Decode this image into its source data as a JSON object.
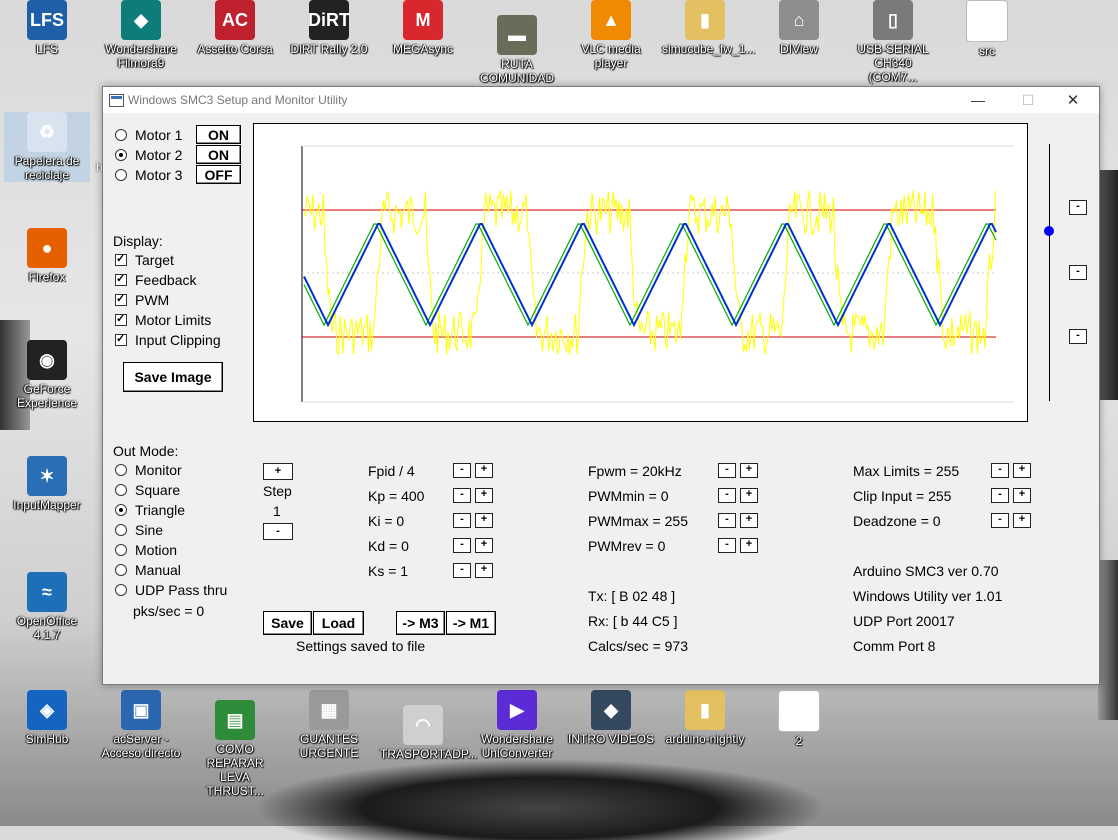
{
  "desktop": {
    "icons": [
      {
        "id": "lfs",
        "label": "LFS",
        "color": "#1f5fa8",
        "glyph": "LFS"
      },
      {
        "id": "filmora",
        "label": "Wondershare Filmora9",
        "color": "#0e7c7b",
        "glyph": "◆"
      },
      {
        "id": "assetto",
        "label": "Assetto Corsa",
        "color": "#c0212f",
        "glyph": "AC"
      },
      {
        "id": "dirt",
        "label": "DiRT Rally 2.0",
        "color": "#222222",
        "glyph": "DiRT"
      },
      {
        "id": "megasync",
        "label": "MEGAsync",
        "color": "#d9272e",
        "glyph": "M"
      },
      {
        "id": "ruta",
        "label": "RUTA COMUNIDAD",
        "color": "#6b6b5a",
        "glyph": "▬"
      },
      {
        "id": "vlc",
        "label": "VLC media player",
        "color": "#f08a00",
        "glyph": "▲"
      },
      {
        "id": "simucube",
        "label": "simucube_fw_1...",
        "color": "#e3c060",
        "glyph": "▮"
      },
      {
        "id": "diview",
        "label": "DIView",
        "color": "#8d8d8d",
        "glyph": "⌂"
      },
      {
        "id": "usbserial",
        "label": "USB-SERIAL CH340 (COM7...",
        "color": "#7a7a7a",
        "glyph": "▯"
      },
      {
        "id": "src",
        "label": "src",
        "color": "#ffffff",
        "glyph": ""
      },
      {
        "id": "recycle",
        "label": "Papelera de reciclaje",
        "color": "#d7e3ef",
        "glyph": "♻"
      },
      {
        "id": "firefox",
        "label": "Firefox",
        "color": "#e66000",
        "glyph": "●"
      },
      {
        "id": "geforce",
        "label": "GeForce Experience",
        "color": "#222222",
        "glyph": "◉"
      },
      {
        "id": "inputmapper",
        "label": "InputMapper",
        "color": "#2a6fb5",
        "glyph": "✶"
      },
      {
        "id": "openoffice",
        "label": "OpenOffice 4.1.7",
        "color": "#1d6fb8",
        "glyph": "≈"
      },
      {
        "id": "simhub",
        "label": "SimHub",
        "color": "#1565c0",
        "glyph": "◈"
      },
      {
        "id": "acserver",
        "label": "acServer - Acceso directo",
        "color": "#2b66b0",
        "glyph": "▣"
      },
      {
        "id": "reparar",
        "label": "COMO REPARAR LEVA THRUST...",
        "color": "#2e8b3a",
        "glyph": "▤"
      },
      {
        "id": "guantes",
        "label": "GUANTES URGENTE",
        "color": "#9a9a9a",
        "glyph": "▦"
      },
      {
        "id": "trasportadp",
        "label": "TRASPORTADP...",
        "color": "#cfcfcf",
        "glyph": "◠"
      },
      {
        "id": "uniconverter",
        "label": "Wondershare UniConverter",
        "color": "#5b2bd6",
        "glyph": "▶"
      },
      {
        "id": "introvideos",
        "label": "INTRO VIDEOS",
        "color": "#34495e",
        "glyph": "◆"
      },
      {
        "id": "arduino",
        "label": "arduino-nightly",
        "color": "#e3c060",
        "glyph": "▮"
      },
      {
        "id": "two",
        "label": "2",
        "color": "#ffffff",
        "glyph": ""
      }
    ],
    "partial_label": "h"
  },
  "window": {
    "title": "Windows SMC3 Setup and Monitor Utility",
    "minimize_glyph": "—",
    "maximize_glyph": "☐",
    "close_glyph": "✕"
  },
  "motors": [
    {
      "label": "Motor 1",
      "state": "ON",
      "selected": false
    },
    {
      "label": "Motor 2",
      "state": "ON",
      "selected": true
    },
    {
      "label": "Motor 3",
      "state": "OFF",
      "selected": false
    }
  ],
  "display": {
    "heading": "Display:",
    "items": [
      {
        "label": "Target",
        "checked": true
      },
      {
        "label": "Feedback",
        "checked": true
      },
      {
        "label": "PWM",
        "checked": true
      },
      {
        "label": "Motor Limits",
        "checked": true
      },
      {
        "label": "Input Clipping",
        "checked": true
      }
    ],
    "save_image": "Save Image"
  },
  "plot": {
    "colors": {
      "limit": "#cc0000",
      "target": "#00b000",
      "feedback": "#0030d0",
      "pwm": "#ffff00",
      "midline": "#cccccc",
      "axis": "#000000"
    },
    "slider_marker_color": "#0000ff"
  },
  "side_buttons": [
    "-",
    "-",
    "-"
  ],
  "out_mode": {
    "heading": "Out Mode:",
    "options": [
      {
        "label": "Monitor",
        "selected": false
      },
      {
        "label": "Square",
        "selected": false
      },
      {
        "label": "Triangle",
        "selected": true
      },
      {
        "label": "Sine",
        "selected": false
      },
      {
        "label": "Motion",
        "selected": false
      },
      {
        "label": "Manual",
        "selected": false
      },
      {
        "label": "UDP Pass thru",
        "selected": false
      }
    ],
    "pks": "pks/sec = 0"
  },
  "step": {
    "plus": "+",
    "label": "Step",
    "value": "1",
    "minus": "-"
  },
  "pid": [
    {
      "label": "Fpid / 4"
    },
    {
      "label": "Kp = 400"
    },
    {
      "label": "Ki = 0"
    },
    {
      "label": "Kd = 0"
    },
    {
      "label": "Ks = 1"
    }
  ],
  "pwm": [
    {
      "label": "Fpwm = 20kHz"
    },
    {
      "label": "PWMmin = 0"
    },
    {
      "label": "PWMmax = 255"
    },
    {
      "label": "PWMrev = 0"
    }
  ],
  "limits": [
    {
      "label": "Max Limits = 255"
    },
    {
      "label": "Clip Input = 255"
    },
    {
      "label": "Deadzone = 0"
    }
  ],
  "pm": {
    "minus": "-",
    "plus": "+"
  },
  "status": {
    "tx": "Tx: [ B 02 48 ]",
    "rx": "Rx: [ b 44 C5 ]",
    "calcs": "Calcs/sec = 973",
    "arduino": "Arduino SMC3 ver 0.70",
    "utility": "Windows Utility ver 1.01",
    "udp": "UDP Port 20017",
    "comm": "Comm Port 8"
  },
  "file_buttons": {
    "save": "Save",
    "load": "Load",
    "m3": "-> M3",
    "m1": "-> M1",
    "saved_msg": "Settings saved to file"
  }
}
